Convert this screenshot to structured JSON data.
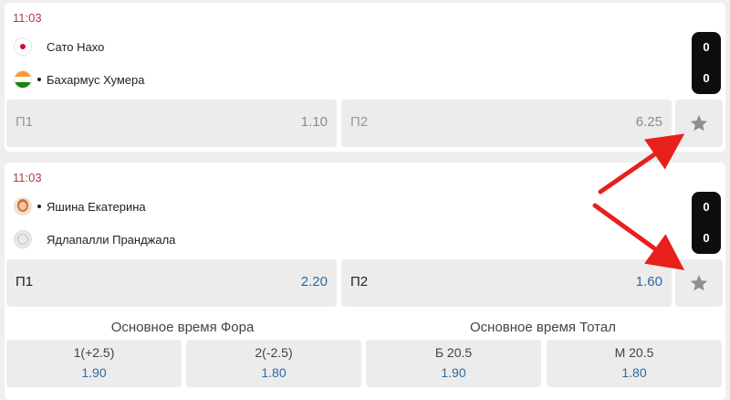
{
  "matches": [
    {
      "time": "11:03",
      "players": [
        {
          "name": "Сато Нахо",
          "flag": "japan-flag-icon",
          "serving": false
        },
        {
          "name": "Бахармус Хумера",
          "flag": "india-flag-icon",
          "serving": true
        }
      ],
      "scores": [
        "0",
        "0"
      ],
      "odds": [
        {
          "label": "П1",
          "value": "1.10"
        },
        {
          "label": "П2",
          "value": "6.25"
        }
      ]
    },
    {
      "time": "11:03",
      "players": [
        {
          "name": "Яшина Екатерина",
          "flag": "player-avatar-icon",
          "serving": true
        },
        {
          "name": "Ядлапалли Пранджала",
          "flag": "tennis-ball-icon",
          "serving": false
        }
      ],
      "scores": [
        "0",
        "0"
      ],
      "odds": [
        {
          "label": "П1",
          "value": "2.20"
        },
        {
          "label": "П2",
          "value": "1.60"
        }
      ]
    }
  ],
  "markets": [
    {
      "title": "Основное время Фора",
      "options": [
        {
          "label": "1(+2.5)",
          "value": "1.90"
        },
        {
          "label": "2(-2.5)",
          "value": "1.80"
        }
      ]
    },
    {
      "title": "Основное время Тотал",
      "options": [
        {
          "label": "Б 20.5",
          "value": "1.90"
        },
        {
          "label": "М 20.5",
          "value": "1.80"
        }
      ]
    }
  ],
  "colors": {
    "arrow": "#e8201c",
    "odds_value": "#2d6aa3",
    "time": "#b23a48"
  },
  "icons": {
    "favorite": "star-icon"
  }
}
